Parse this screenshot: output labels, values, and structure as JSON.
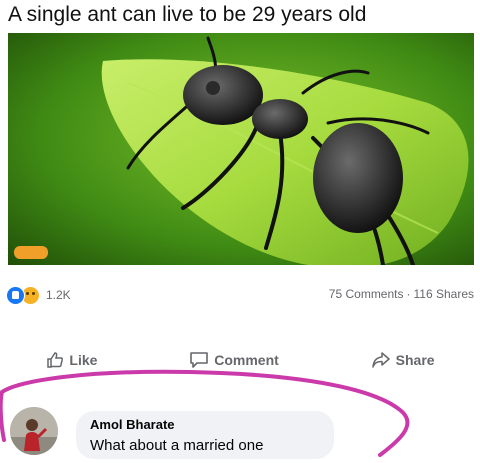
{
  "post": {
    "caption": "A single ant can live to be 29 years old",
    "photo_icon": "ant-on-leaf-photo"
  },
  "stats": {
    "reaction_icons": [
      "like-reaction-icon",
      "wow-reaction-icon"
    ],
    "reaction_count": "1.2K",
    "comments": "75 Comments",
    "separator": "·",
    "shares": "116 Shares"
  },
  "actions": {
    "like_label": "Like",
    "comment_label": "Comment",
    "share_label": "Share"
  },
  "comment": {
    "author": "Amol Bharate",
    "text": "What about a married one"
  },
  "colors": {
    "like_blue": "#1877f2",
    "wow_yellow": "#f7b125",
    "muted_text": "#65676b",
    "bubble_bg": "#f0f2f5",
    "highlight_magenta": "#c2179b"
  }
}
